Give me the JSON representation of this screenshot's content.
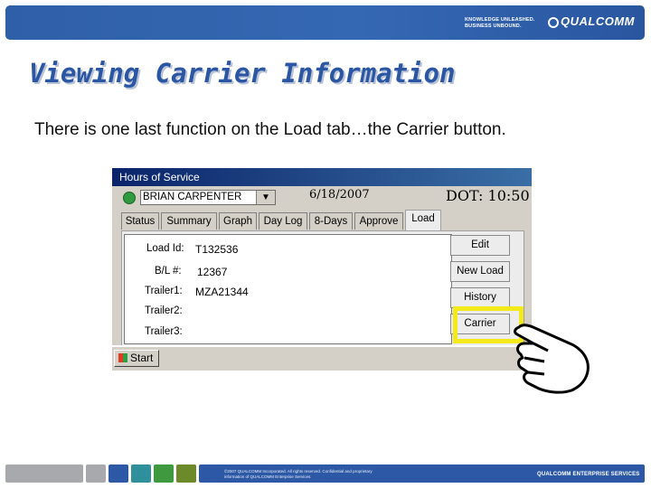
{
  "header": {
    "tagline_line1": "KNOWLEDGE UNLEASHED.",
    "tagline_line2": "BUSINESS UNBOUND.",
    "brand": "QUALCOMM"
  },
  "slide": {
    "title": "Viewing Carrier Information",
    "subtitle": "There is one last function on the Load tab…the Carrier button."
  },
  "app": {
    "window_title": "Hours of Service",
    "driver": "BRIAN CARPENTER",
    "date": "6/18/2007",
    "dot_time": "DOT: 10:50",
    "tabs": [
      "Status",
      "Summary",
      "Graph",
      "Day Log",
      "8-Days",
      "Approve",
      "Load"
    ],
    "active_tab": "Load",
    "fields": [
      {
        "label": "Load Id:",
        "value": "T132536"
      },
      {
        "label": "B/L #:",
        "value": "12367"
      },
      {
        "label": "Trailer1:",
        "value": "MZA21344"
      },
      {
        "label": "Trailer2:",
        "value": ""
      },
      {
        "label": "Trailer3:",
        "value": ""
      }
    ],
    "buttons": [
      "Edit",
      "New Load",
      "History",
      "Carrier"
    ],
    "start_label": "Start"
  },
  "footer": {
    "legal": "©2007 QUALCOMM Incorporated. All rights reserved. Confidential and proprietary information of QUALCOMM Enterprise Services.",
    "brand": "QUALCOMM ENTERPRISE SERVICES"
  },
  "colors": {
    "accent": "#2b56a3",
    "highlight": "#f2ea1b",
    "footer_segments": [
      "#a7a9ac",
      "#a7a9ac",
      "#2d58a5",
      "#2f8f9b",
      "#3f9a3f",
      "#6d8a2a",
      "#2d58a5"
    ]
  }
}
